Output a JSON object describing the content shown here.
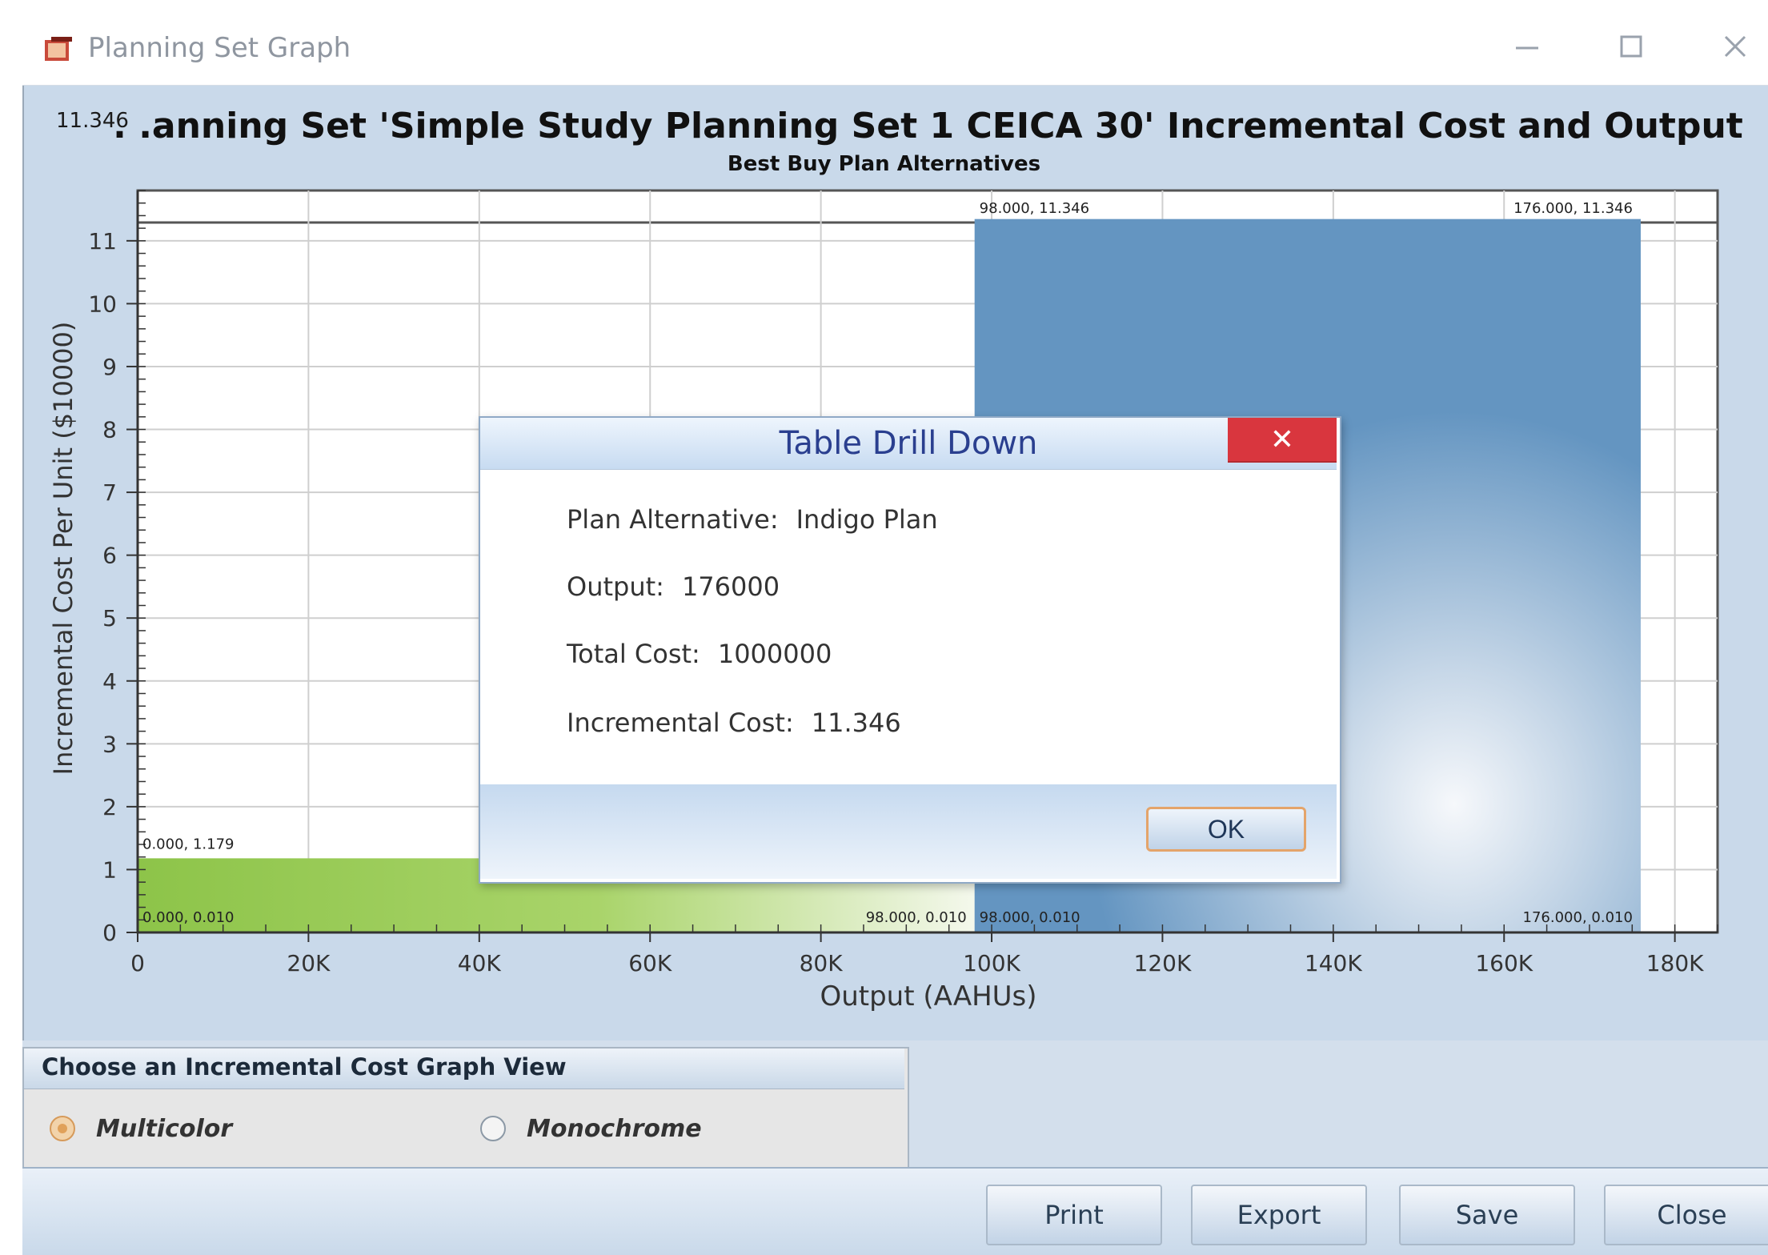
{
  "window": {
    "title": "Planning Set Graph",
    "minimize_label": "—",
    "maximize_label": "☐",
    "close_label": "✕"
  },
  "chart_data": {
    "type": "bar",
    "title": ". .anning Set 'Simple Study Planning Set 1 CEICA 30' Incremental Cost and Output",
    "subtitle": "Best Buy Plan Alternatives",
    "corner_label": "11.346",
    "xlabel": "Output (AAHUs)",
    "ylabel": "Incremental Cost Per Unit ($10000)",
    "xlim": [
      0,
      185000
    ],
    "ylim": [
      0,
      11.8
    ],
    "x_ticks": [
      0,
      20000,
      40000,
      60000,
      80000,
      100000,
      120000,
      140000,
      160000,
      180000
    ],
    "x_tick_labels": [
      "0",
      "20K",
      "40K",
      "60K",
      "80K",
      "100K",
      "120K",
      "140K",
      "160K",
      "180K"
    ],
    "y_ticks": [
      0,
      1,
      2,
      3,
      4,
      5,
      6,
      7,
      8,
      9,
      10,
      11
    ],
    "y_tick_labels": [
      "0",
      "1",
      "2",
      "3",
      "4",
      "5",
      "6",
      "7",
      "8",
      "9",
      "10",
      "11"
    ],
    "grid": true,
    "bars": [
      {
        "x_start": 0,
        "x_end": 98000,
        "value": 1.179,
        "color": "#8dc449"
      },
      {
        "x_start": 98000,
        "x_end": 176000,
        "value": 11.346,
        "color": "#5f90bc"
      }
    ],
    "annotations": [
      {
        "x": 0,
        "y": 1.179,
        "text": "0.000, 1.179"
      },
      {
        "x": 0,
        "y": 0.01,
        "text": "0.000, 0.010"
      },
      {
        "x": 98000,
        "y": 0.01,
        "text": "98.000, 0.010",
        "anchor": "end"
      },
      {
        "x": 98000,
        "y": 0.01,
        "text": "98.000, 0.010"
      },
      {
        "x": 98000,
        "y": 11.346,
        "text": "98.000, 11.346"
      },
      {
        "x": 176000,
        "y": 11.346,
        "text": "176.000, 11.346",
        "anchor": "end"
      },
      {
        "x": 176000,
        "y": 0.01,
        "text": "176.000, 0.010",
        "anchor": "end"
      }
    ]
  },
  "view_options": {
    "group_title": "Choose an Incremental Cost Graph View",
    "multicolor_label": "Multicolor",
    "monochrome_label": "Monochrome",
    "selected": "Multicolor"
  },
  "buttons": {
    "print": "Print",
    "export": "Export",
    "save": "Save",
    "close": "Close"
  },
  "dialog": {
    "title": "Table Drill Down",
    "close_label": "✕",
    "plan_alternative_label": "Plan Alternative:",
    "plan_alternative_value": "Indigo Plan",
    "output_label": "Output:",
    "output_value": "176000",
    "total_cost_label": "Total Cost:",
    "total_cost_value": "1000000",
    "incremental_cost_label": "Incremental Cost:",
    "incremental_cost_value": "11.346",
    "ok_label": "OK"
  }
}
